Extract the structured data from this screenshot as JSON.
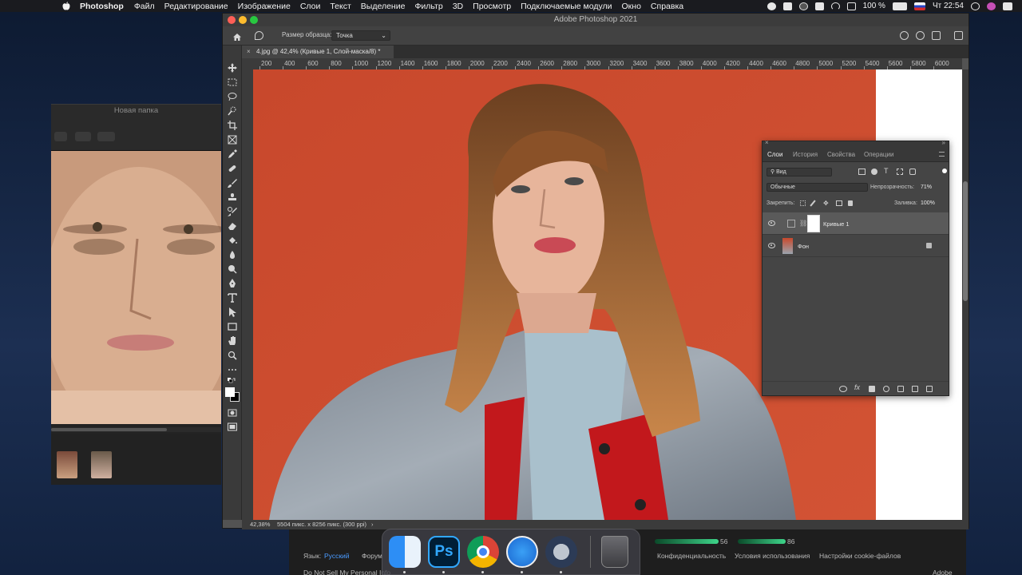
{
  "menubar": {
    "app_name": "Photoshop",
    "items": [
      "Файл",
      "Редактирование",
      "Изображение",
      "Слои",
      "Текст",
      "Выделение",
      "Фильтр",
      "3D",
      "Просмотр",
      "Подключаемые модули",
      "Окно",
      "Справка"
    ],
    "battery": "100 %",
    "clock": "Чт 22:54"
  },
  "finder": {
    "title": "Новая папка"
  },
  "photoshop": {
    "window_title": "Adobe Photoshop 2021",
    "options": {
      "sample_size_label": "Размер образца:",
      "sample_size_value": "Точка"
    },
    "doc_tab": "4.jpg @ 42,4% (Кривые 1, Слой-маска/8) *",
    "ruler_labels": [
      "200",
      "400",
      "600",
      "800",
      "1000",
      "1200",
      "1400",
      "1600",
      "1800",
      "2000",
      "2200",
      "2400",
      "2600",
      "2800",
      "3000",
      "3200",
      "3400",
      "3600",
      "3800",
      "4000",
      "4200",
      "4400",
      "4600",
      "4800",
      "5000",
      "5200",
      "5400",
      "5600",
      "5800",
      "6000"
    ],
    "status": {
      "zoom": "42,38%",
      "info": "5504 пикс. x 8256 пикс. (300 ppi)"
    }
  },
  "layers_panel": {
    "tabs": [
      "Слои",
      "История",
      "Свойства",
      "Операции"
    ],
    "active_tab": "Слои",
    "filter": "Вид",
    "blend_mode": "Обычные",
    "opacity_label": "Непрозрачность:",
    "opacity_value": "71%",
    "lock_label": "Закрепить:",
    "fill_label": "Заливка:",
    "fill_value": "100%",
    "layers": [
      {
        "name": "Кривые 1",
        "selected": true
      },
      {
        "name": "Фон",
        "selected": false,
        "locked": true
      }
    ]
  },
  "web_footer": {
    "lang_label": "Язык:",
    "lang_value": "Русский",
    "forum": "Форум",
    "privacy": "Конфиденциальность",
    "terms": "Условия использования",
    "cookies": "Настройки cookie-файлов",
    "do_not_sell": "Do Not Sell My Personal Info",
    "slider1_value": "56",
    "slider2_value": "86",
    "brand": "Adobe"
  },
  "dock": {
    "apps": [
      "finder-icon",
      "photoshop-icon",
      "chrome-icon",
      "safari-icon",
      "quicktime-icon",
      "trash-icon"
    ],
    "ps_label": "Ps"
  }
}
